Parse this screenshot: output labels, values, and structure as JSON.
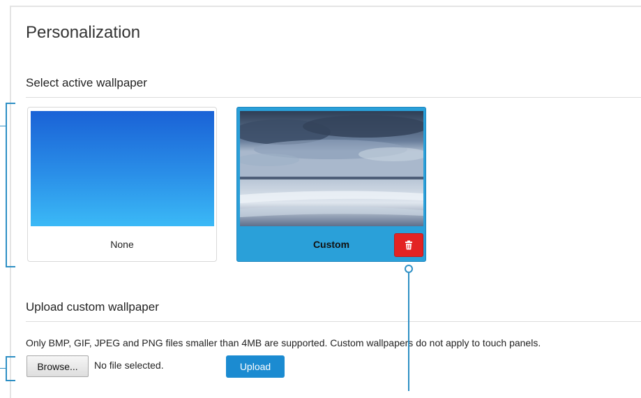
{
  "page": {
    "title": "Personalization"
  },
  "wallpaper_section": {
    "title": "Select active wallpaper",
    "options": [
      {
        "label": "None",
        "selected": false
      },
      {
        "label": "Custom",
        "selected": true,
        "delete_icon": "trash-icon"
      }
    ]
  },
  "upload_section": {
    "title": "Upload custom wallpaper",
    "description": "Only BMP, GIF, JPEG and PNG files smaller than 4MB are supported. Custom wallpapers do not apply to touch panels.",
    "browse_label": "Browse...",
    "file_status": "No file selected.",
    "upload_label": "Upload"
  },
  "colors": {
    "accent": "#2aa0d9",
    "delete": "#e32323",
    "upload_button": "#1b8bd1",
    "callout": "#2d8fc4"
  }
}
